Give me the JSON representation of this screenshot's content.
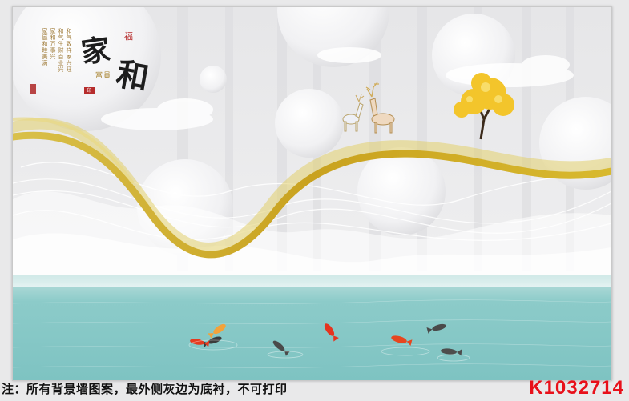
{
  "artwork": {
    "calligraphy_chars": [
      "家",
      "和"
    ],
    "seal_char": "福",
    "sub_mark": "富貴",
    "stamp_char": "印",
    "poem_lines": [
      "和气致祥家兴旺",
      "和气生财百业兴",
      "家和万事兴",
      "家庭和睦美满"
    ],
    "colors": {
      "background": "#e9e9ea",
      "sky": "#eaeaec",
      "ribbon_gold": "#d8b92e",
      "water": "#7fc6c6",
      "tree": "#f3c52b",
      "notice_text": "#111111",
      "code_text": "#e8101a"
    }
  },
  "footer": {
    "notice": "注：所有背景墙图案，最外侧灰边为底衬，不可打印",
    "product_code": "K1032714"
  }
}
